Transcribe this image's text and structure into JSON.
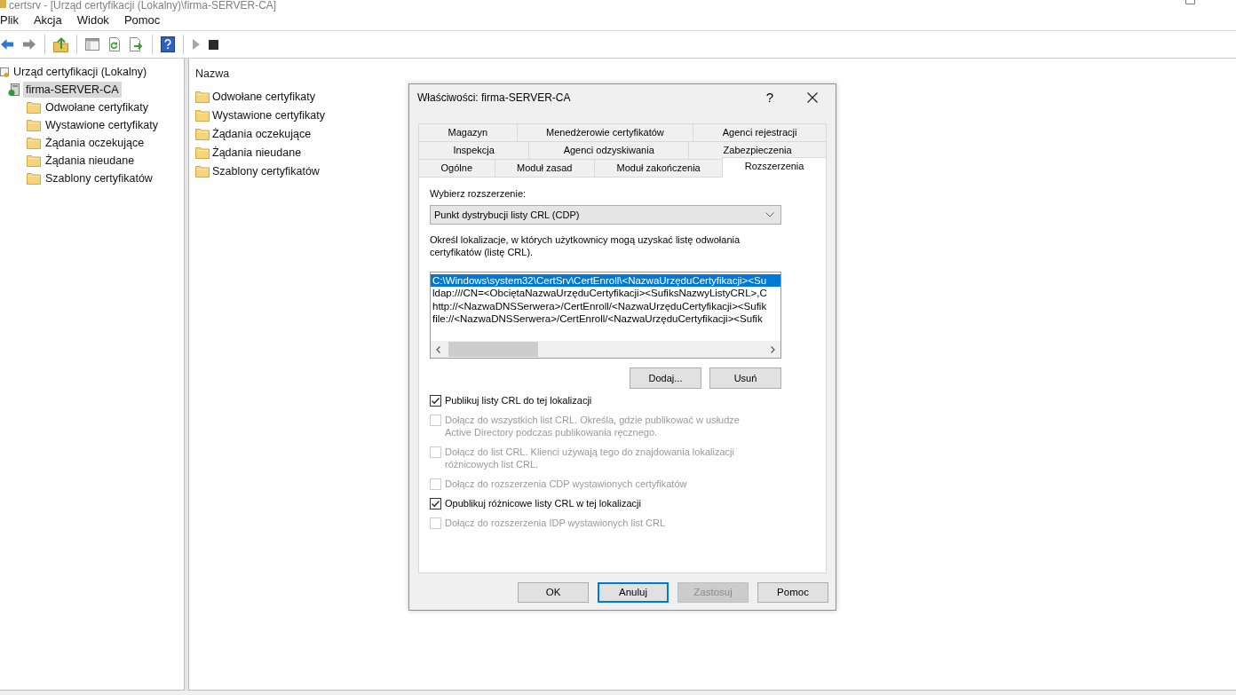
{
  "window": {
    "title": "certsrv - [Urząd certyfikacji (Lokalny)\\firma-SERVER-CA]"
  },
  "menu": [
    {
      "label": "Plik"
    },
    {
      "label": "Akcja"
    },
    {
      "label": "Widok"
    },
    {
      "label": "Pomoc"
    }
  ],
  "toolbar": [
    [
      {
        "kind": "back",
        "disabled": false
      },
      {
        "kind": "forward",
        "disabled": true
      }
    ],
    [
      {
        "kind": "up",
        "disabled": false
      }
    ],
    [
      {
        "kind": "tree",
        "disabled": false
      },
      {
        "kind": "refresh",
        "disabled": false
      },
      {
        "kind": "export",
        "disabled": false
      }
    ],
    [
      {
        "kind": "help",
        "disabled": false
      }
    ],
    [
      {
        "kind": "play",
        "disabled": true
      },
      {
        "kind": "stop",
        "disabled": false
      }
    ]
  ],
  "tree": [
    {
      "label": "Urząd certyfikacji (Lokalny)",
      "kind": "authority",
      "selected": false,
      "children": [
        {
          "label": "firma-SERVER-CA",
          "kind": "server",
          "selected": true,
          "children": [
            {
              "label": "Odwołane certyfikaty",
              "kind": "folder",
              "selected": false
            },
            {
              "label": "Wystawione certyfikaty",
              "kind": "folder",
              "selected": false
            },
            {
              "label": "Żądania oczekujące",
              "kind": "folder",
              "selected": false
            },
            {
              "label": "Żądania nieudane",
              "kind": "folder",
              "selected": false
            },
            {
              "label": "Szablony certyfikatów",
              "kind": "folder",
              "selected": false
            }
          ]
        }
      ]
    }
  ],
  "list": {
    "column": "Nazwa",
    "items": [
      {
        "label": "Odwołane certyfikaty"
      },
      {
        "label": "Wystawione certyfikaty"
      },
      {
        "label": "Żądania oczekujące"
      },
      {
        "label": "Żądania nieudane"
      },
      {
        "label": "Szablony certyfikatów"
      }
    ]
  },
  "dialog": {
    "title": "Właściwości: firma-SERVER-CA",
    "help": "?",
    "tab_rows": [
      [
        {
          "label": "Magazyn",
          "selected": false
        },
        {
          "label": "Menedżerowie certyfikatów",
          "selected": false
        },
        {
          "label": "Agenci rejestracji",
          "selected": false
        }
      ],
      [
        {
          "label": "Inspekcja",
          "selected": false
        },
        {
          "label": "Agenci odzyskiwania",
          "selected": false
        },
        {
          "label": "Zabezpieczenia",
          "selected": false
        }
      ],
      [
        {
          "label": "Ogólne",
          "selected": false
        },
        {
          "label": "Moduł zasad",
          "selected": false
        },
        {
          "label": "Moduł zakończenia",
          "selected": false
        },
        {
          "label": "Rozszerzenia",
          "selected": true
        }
      ]
    ],
    "extension_label": "Wybierz rozszerzenie:",
    "extension": {
      "value": "Punkt dystrybucji listy CRL (CDP)"
    },
    "description": "Określ lokalizacje, w których użytkownicy mogą uzyskać listę odwołania certyfikatów (listę CRL).",
    "locations": [
      {
        "text": "C:\\Windows\\system32\\CertSrv\\CertEnroll\\<NazwaUrzęduCertyfikacji><Su",
        "selected": true
      },
      {
        "text": "ldap:///CN=<ObciętaNazwaUrzęduCertyfikacji><SufiksNazwyListyCRL>,C",
        "selected": false
      },
      {
        "text": "http://<NazwaDNSSerwera>/CertEnroll/<NazwaUrzęduCertyfikacji><Sufik",
        "selected": false
      },
      {
        "text": "file://<NazwaDNSSerwera>/CertEnroll/<NazwaUrzęduCertyfikacji><Sufik",
        "selected": false
      }
    ],
    "location_buttons": [
      {
        "label": "Dodaj..."
      },
      {
        "label": "Usuń"
      }
    ],
    "options": [
      {
        "label": "Publikuj listy CRL do tej lokalizacji",
        "checked": true,
        "disabled": false
      },
      {
        "label": "Dołącz do wszystkich list CRL. Określa, gdzie publikować w usłudze Active Directory podczas publikowania ręcznego.",
        "checked": false,
        "disabled": true
      },
      {
        "label": "Dołącz do list CRL. Klienci używają tego do znajdowania lokalizacji różnicowych list CRL.",
        "checked": false,
        "disabled": true
      },
      {
        "label": "Dołącz do rozszerzenia CDP wystawionych certyfikatów",
        "checked": false,
        "disabled": true
      },
      {
        "label": "Opublikuj różnicowe listy CRL w tej lokalizacji",
        "checked": true,
        "disabled": false
      },
      {
        "label": "Dołącz do rozszerzenia IDP wystawionych list CRL",
        "checked": false,
        "disabled": true
      }
    ],
    "buttons": [
      {
        "label": "OK",
        "focused": false,
        "disabled": false
      },
      {
        "label": "Anuluj",
        "focused": true,
        "disabled": false
      },
      {
        "label": "Zastosuj",
        "focused": false,
        "disabled": true
      },
      {
        "label": "Pomoc",
        "focused": false,
        "disabled": false
      }
    ]
  }
}
